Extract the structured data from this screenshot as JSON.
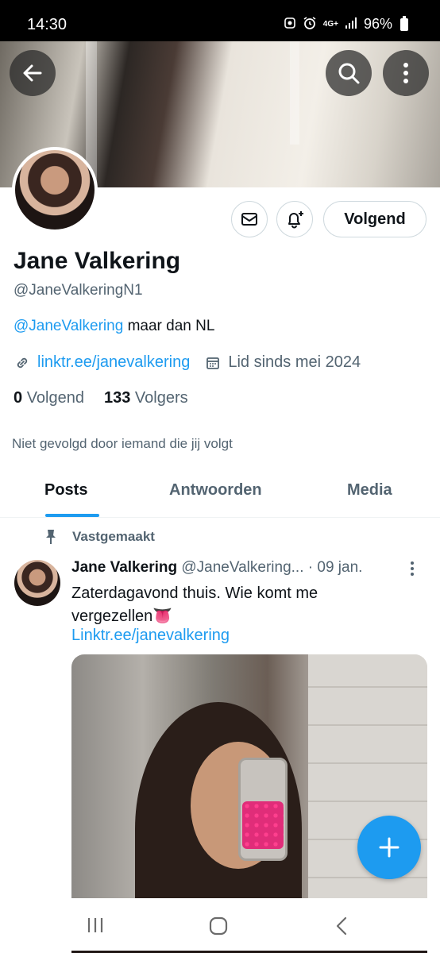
{
  "status_bar": {
    "time": "14:30",
    "network": "4G+",
    "battery": "96%",
    "icons": [
      "notification-icon",
      "alarm-icon",
      "network-icon",
      "signal-icon",
      "battery-icon"
    ]
  },
  "banner": {
    "icons": [
      "arrow-left-icon",
      "search-icon",
      "more-vertical-icon"
    ]
  },
  "profile": {
    "display_name": "Jane Valkering",
    "handle": "@JaneValkeringN1",
    "bio_mention": "@JaneValkering",
    "bio_rest": " maar dan NL",
    "website": "linktr.ee/janevalkering",
    "joined": "Lid sinds mei 2024",
    "following_count": "0",
    "following_label": "Volgend",
    "followers_count": "133",
    "followers_label": "Volgers",
    "not_followed_text": "Niet gevolgd door iemand die jij volgt"
  },
  "actions": {
    "follow_state_label": "Volgend",
    "icons": [
      "envelope-icon",
      "bell-plus-icon"
    ]
  },
  "tabs": [
    {
      "label": "Posts",
      "active": true
    },
    {
      "label": "Antwoorden",
      "active": false
    },
    {
      "label": "Media",
      "active": false
    }
  ],
  "pinned_post": {
    "pinned_label": "Vastgemaakt",
    "author_name": "Jane Valkering",
    "author_handle": "@JaneValkering...",
    "date": "· 09 jan.",
    "text": "Zaterdagavond thuis. Wie komt me vergezellen👅",
    "link": "Linktr.ee/janevalkering"
  },
  "colors": {
    "accent": "#1d9bf0",
    "text_primary": "#0f1419",
    "text_secondary": "#536471",
    "border": "#cfd9de"
  },
  "nav_bar": {
    "icons": [
      "recent-apps-icon",
      "home-icon",
      "back-icon"
    ]
  }
}
